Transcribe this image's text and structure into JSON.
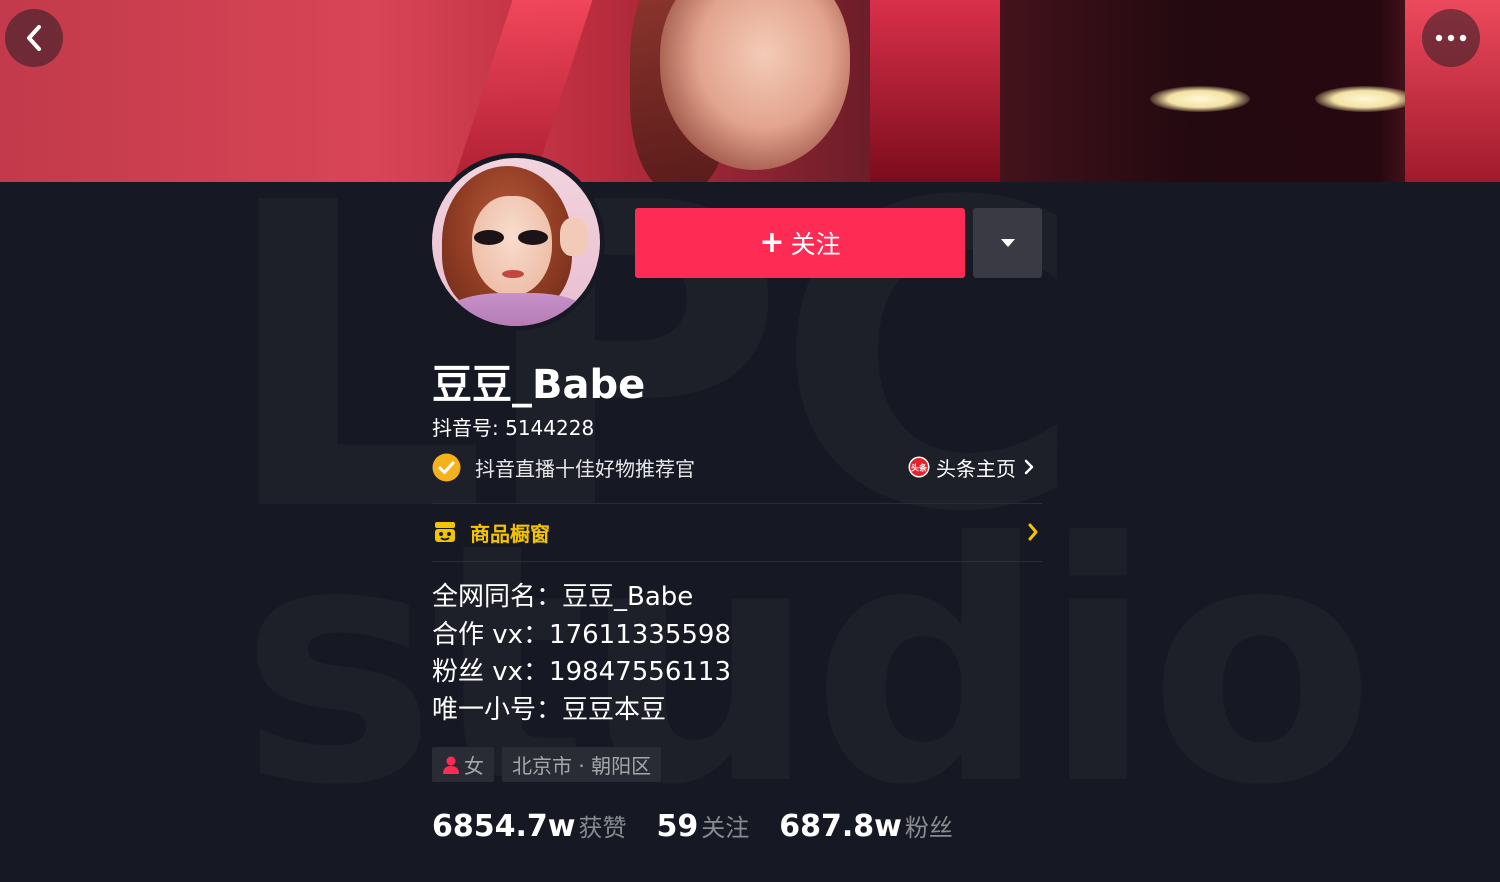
{
  "header": {
    "back_icon": "chevron-left-icon",
    "more_icon": "ellipsis-icon"
  },
  "watermark": {
    "top": "LPC",
    "bottom": "studio"
  },
  "profile": {
    "name": "豆豆_Babe",
    "douyin_id": "抖音号: 5144228",
    "verification": "抖音直播十佳好物推荐官",
    "toutiao_link": "头条主页",
    "toutiao_badge": "头条"
  },
  "actions": {
    "follow_label": "关注",
    "follow_color": "#fe2c55"
  },
  "shop": {
    "label": "商品橱窗",
    "color": "#f5c400"
  },
  "bio": [
    "全网同名：豆豆_Babe",
    "合作 vx：17611335598",
    "粉丝 vx：19847556113",
    "唯一小号：豆豆本豆"
  ],
  "tags": {
    "gender": "女",
    "location": "北京市 · 朝阳区"
  },
  "stats": {
    "likes_value": "6854.7w",
    "likes_label": "获赞",
    "following_value": "59",
    "following_label": "关注",
    "followers_value": "687.8w",
    "followers_label": "粉丝"
  }
}
